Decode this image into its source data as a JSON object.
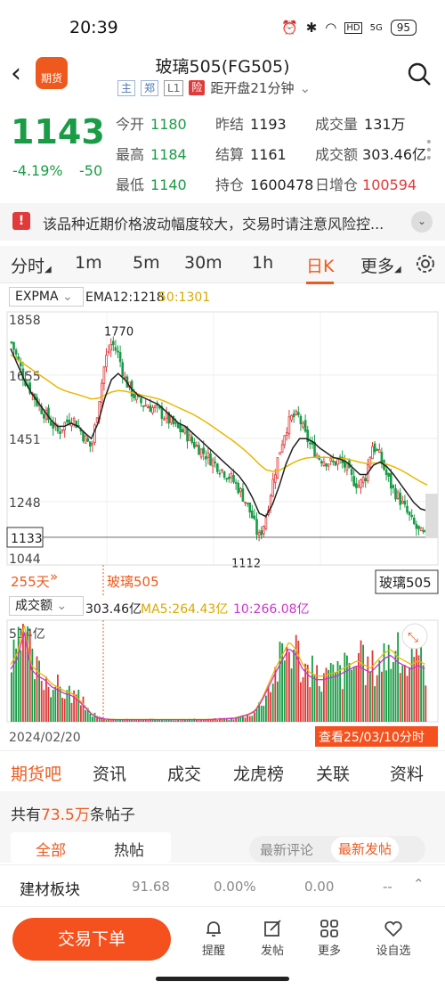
{
  "status": {
    "time": "20:39",
    "battery": "95",
    "net": "5G",
    "hd": "HD"
  },
  "header": {
    "logo": "期货",
    "title": "玻璃505(FG505)",
    "tags": [
      "主",
      "郑",
      "L1",
      "险"
    ],
    "sub": "距开盘21分钟"
  },
  "quote": {
    "price": "1143",
    "chg_pct": "-4.19%",
    "chg": "-50",
    "cells": [
      {
        "l": "今开",
        "v": "1180",
        "c": "g"
      },
      {
        "l": "昨结",
        "v": "1193",
        "c": "k"
      },
      {
        "l": "成交量",
        "v": "131万",
        "c": "k"
      },
      {
        "l": "最高",
        "v": "1184",
        "c": "g"
      },
      {
        "l": "结算",
        "v": "1161",
        "c": "k"
      },
      {
        "l": "成交额",
        "v": "303.46亿",
        "c": "k"
      },
      {
        "l": "最低",
        "v": "1140",
        "c": "g"
      },
      {
        "l": "持仓",
        "v": "1600478",
        "c": "k"
      },
      {
        "l": "日增仓",
        "v": "100594",
        "c": "r"
      }
    ]
  },
  "risk": {
    "text": "该品种近期价格波动幅度较大，交易时请注意风险控..."
  },
  "periods": [
    "分时",
    "1m",
    "5m",
    "30m",
    "1h",
    "日K",
    "更多"
  ],
  "indicator": {
    "name": "EXPMA",
    "ema12": "EMA12:1218",
    "ema50": "50:1301"
  },
  "chart": {
    "ylabels": [
      "1858",
      "1655",
      "1451",
      "1248",
      "1044"
    ],
    "high_label": "1770",
    "low_label": "1112",
    "cur": "1133",
    "days": "255天",
    "name": "玻璃505",
    "name2": "玻璃505"
  },
  "volume": {
    "name": "成交额",
    "val": "303.46亿",
    "ma5": "MA5:264.43亿",
    "ma10": "10:266.08亿",
    "ymax": "514亿",
    "date": "2024/02/20",
    "view": "查看25/03/10分时"
  },
  "bottom_tabs": [
    "期货吧",
    "资讯",
    "成交",
    "龙虎榜",
    "关联",
    "资料"
  ],
  "posts": {
    "pre": "共有",
    "count": "73.5万",
    "post": "条帖子",
    "seg": [
      "全部",
      "热帖"
    ],
    "sort": [
      "最新评论",
      "最新发帖"
    ]
  },
  "sector": {
    "name": "建材板块",
    "value": "91.68",
    "pct": "0.00%",
    "chg": "0.00",
    "dash": "--"
  },
  "trade": {
    "btn": "交易下单",
    "items": [
      "提醒",
      "发帖",
      "更多",
      "设自选"
    ]
  },
  "colors": {
    "up": "#e03a3a",
    "down": "#1a9c46",
    "accent": "#ee5a1e",
    "ema12": "#222222",
    "ema50": "#e8b800",
    "ma5": "#e8b800",
    "ma10": "#cc33cc"
  },
  "chart_data": {
    "type": "candlestick",
    "title": "玻璃505",
    "ylim": [
      1044,
      1858
    ],
    "yticks": [
      1858,
      1655,
      1451,
      1248,
      1044
    ],
    "x_start": "2024/02/20",
    "x_end": "25/03/10",
    "high": 1770,
    "low": 1112,
    "current": 1133,
    "close_path": [
      1760,
      1700,
      1640,
      1600,
      1560,
      1530,
      1500,
      1470,
      1500,
      1520,
      1490,
      1450,
      1420,
      1560,
      1700,
      1760,
      1720,
      1640,
      1600,
      1570,
      1560,
      1550,
      1540,
      1520,
      1500,
      1480,
      1470,
      1440,
      1420,
      1400,
      1380,
      1360,
      1340,
      1320,
      1290,
      1250,
      1200,
      1130,
      1190,
      1300,
      1400,
      1480,
      1520,
      1520,
      1460,
      1420,
      1390,
      1380,
      1370,
      1380,
      1360,
      1320,
      1300,
      1330,
      1430,
      1400,
      1340,
      1290,
      1260,
      1220,
      1180,
      1150,
      1133
    ],
    "ema12": [
      1740,
      1690,
      1640,
      1600,
      1570,
      1540,
      1510,
      1490,
      1490,
      1500,
      1490,
      1470,
      1450,
      1500,
      1580,
      1640,
      1660,
      1640,
      1610,
      1590,
      1580,
      1570,
      1560,
      1540,
      1520,
      1500,
      1490,
      1470,
      1450,
      1430,
      1410,
      1390,
      1370,
      1350,
      1330,
      1300,
      1260,
      1210,
      1200,
      1240,
      1300,
      1370,
      1420,
      1450,
      1450,
      1440,
      1420,
      1405,
      1390,
      1385,
      1375,
      1355,
      1335,
      1335,
      1365,
      1375,
      1360,
      1335,
      1305,
      1275,
      1245,
      1225,
      1218
    ],
    "ema50": [
      1720,
      1705,
      1690,
      1675,
      1660,
      1645,
      1630,
      1615,
      1605,
      1598,
      1592,
      1585,
      1578,
      1580,
      1590,
      1600,
      1605,
      1603,
      1598,
      1593,
      1588,
      1583,
      1578,
      1570,
      1560,
      1550,
      1540,
      1530,
      1518,
      1505,
      1490,
      1475,
      1460,
      1445,
      1428,
      1410,
      1390,
      1368,
      1350,
      1345,
      1348,
      1360,
      1372,
      1382,
      1388,
      1390,
      1390,
      1390,
      1388,
      1387,
      1385,
      1380,
      1374,
      1370,
      1372,
      1372,
      1368,
      1360,
      1350,
      1338,
      1325,
      1312,
      1301
    ],
    "volume": [
      300,
      360,
      514,
      300,
      260,
      240,
      200,
      180,
      160,
      150,
      120,
      80,
      40,
      20,
      15,
      12,
      12,
      12,
      12,
      12,
      12,
      12,
      12,
      12,
      12,
      12,
      12,
      12,
      12,
      12,
      14,
      16,
      18,
      20,
      30,
      40,
      60,
      120,
      200,
      280,
      350,
      420,
      380,
      300,
      260,
      240,
      240,
      250,
      260,
      280,
      300,
      320,
      300,
      280,
      320,
      360,
      380,
      340,
      320,
      300,
      320,
      303
    ]
  }
}
